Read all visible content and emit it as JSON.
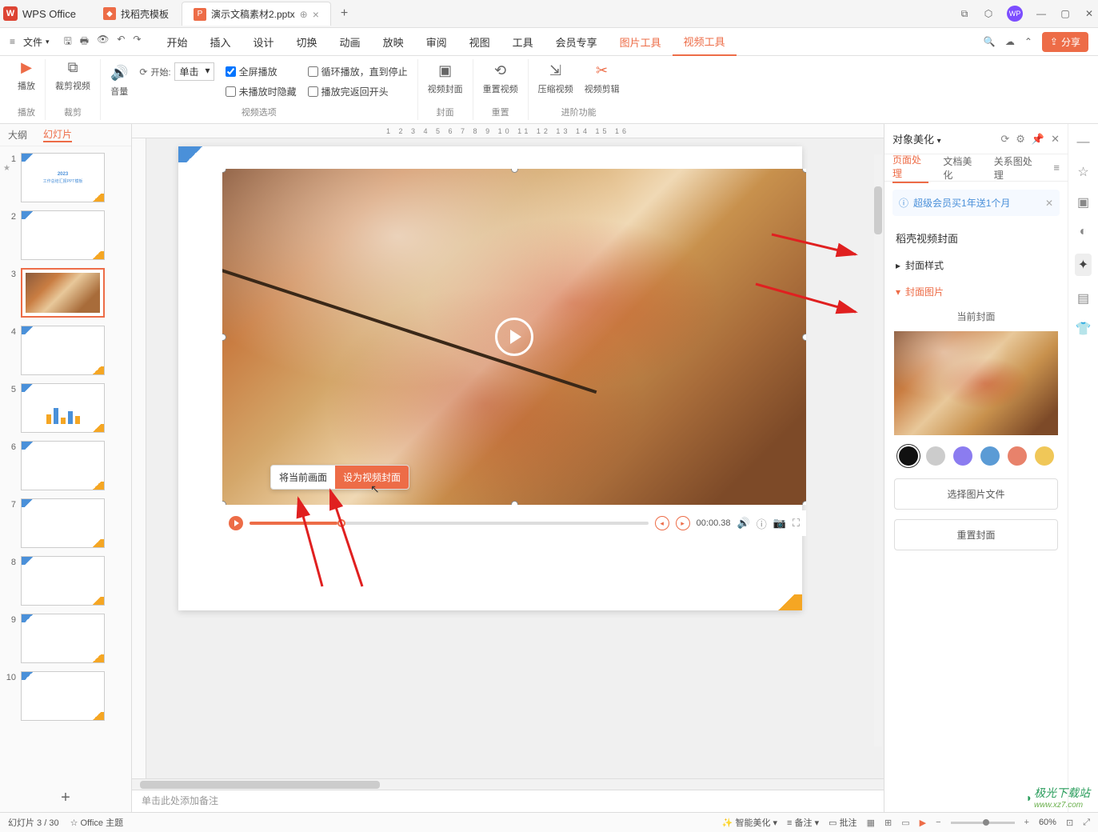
{
  "app": {
    "name": "WPS Office"
  },
  "tabs": [
    {
      "label": "找稻壳模板"
    },
    {
      "label": "演示文稿素材2.pptx",
      "active": true
    }
  ],
  "menu": {
    "file": "文件",
    "items": [
      "开始",
      "插入",
      "设计",
      "切换",
      "动画",
      "放映",
      "审阅",
      "视图",
      "工具",
      "会员专享"
    ],
    "context": [
      "图片工具",
      "视频工具"
    ],
    "share": "分享"
  },
  "ribbon": {
    "play": "播放",
    "play_group": "播放",
    "crop": "裁剪视频",
    "crop_group": "裁剪",
    "volume": "音量",
    "start_label": "开始:",
    "start_value": "单击",
    "fullscreen": "全屏播放",
    "loop": "循环播放，直到停止",
    "hide": "未播放时隐藏",
    "rewind": "播放完返回开头",
    "options_group": "视频选项",
    "cover": "视频封面",
    "reset_cover": "重置视频",
    "cover_group": "封面",
    "reset_group": "重置",
    "compress": "压缩视频",
    "trim": "视频剪辑",
    "advanced_group": "进阶功能"
  },
  "slide_tabs": {
    "outline": "大纲",
    "slides": "幻灯片"
  },
  "slides": [
    1,
    2,
    3,
    4,
    5,
    6,
    7,
    8,
    9,
    10
  ],
  "current_slide": 3,
  "tooltip": {
    "left": "将当前画面",
    "right": "设为视频封面"
  },
  "video": {
    "time": "00:00.38"
  },
  "notes": "单击此处添加备注",
  "side": {
    "title": "对象美化",
    "tabs": [
      "页面处理",
      "文档美化",
      "关系图处理"
    ],
    "promo": "超级会员买1年送1个月",
    "section": "稻壳视频封面",
    "style": "封面样式",
    "image": "封面图片",
    "current": "当前封面",
    "choose": "选择图片文件",
    "reset": "重置封面",
    "colors": [
      "#111",
      "#ccc",
      "#8b7cf0",
      "#5b9bd5",
      "#e8826b",
      "#f0c758"
    ]
  },
  "status": {
    "slide": "幻灯片 3 / 30",
    "theme": "Office 主题",
    "smart": "智能美化",
    "notes": "备注",
    "batch": "批注",
    "zoom": "60%"
  },
  "ruler": "1  2  3  4  5  6  7  8  9  10  11  12  13  14  15  16",
  "watermark": "极光下载站",
  "watermark_url": "www.xz7.com"
}
